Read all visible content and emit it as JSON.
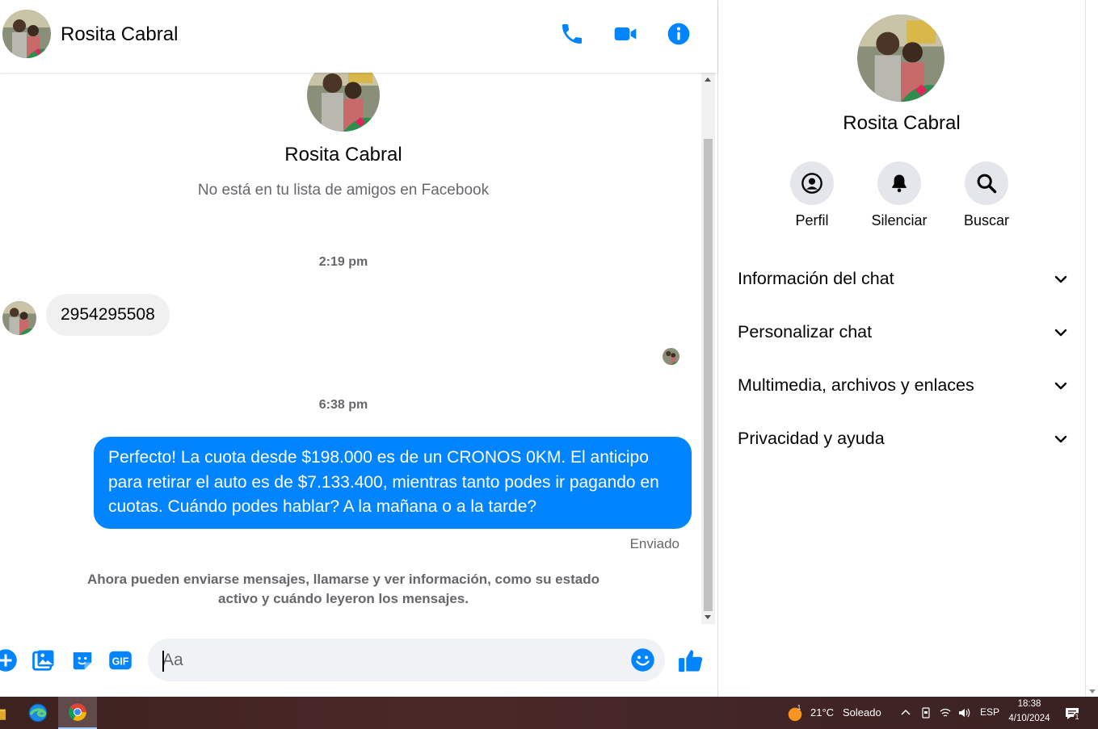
{
  "colors": {
    "accent": "#0084ff",
    "secondary_text": "#65676b",
    "incoming_bubble": "#f0f0f0",
    "panel_button_bg": "#e4e6eb"
  },
  "header": {
    "contact_name": "Rosita Cabral",
    "icons": [
      "phone-icon",
      "video-camera-icon",
      "info-icon"
    ]
  },
  "conversation": {
    "profile_name": "Rosita Cabral",
    "profile_subtitle": "No está en tu lista de amigos en Facebook",
    "messages": [
      {
        "time": "2:19 pm",
        "direction": "incoming",
        "text": "2954295508"
      },
      {
        "time": "6:38 pm",
        "direction": "outgoing",
        "text": "Perfecto! La cuota desde $198.000 es de un CRONOS 0KM. El anticipo para retirar el auto es de $7.133.400, mientras tanto podes ir pagando en cuotas. Cuándo podes hablar? A la mañana o a la tarde?",
        "status": "Enviado"
      }
    ],
    "notice": "Ahora pueden enviarse mensajes, llamarse y ver información, como su estado activo y cuándo leyeron los mensajes."
  },
  "composer": {
    "placeholder": "Aa",
    "value": "",
    "icons": [
      "plus-icon",
      "photo-icon",
      "sticker-icon",
      "gif-icon",
      "emoji-icon",
      "thumbs-up-icon"
    ],
    "gif_label": "GIF"
  },
  "panel": {
    "name": "Rosita Cabral",
    "actions": [
      {
        "label": "Perfil",
        "icon": "profile-icon"
      },
      {
        "label": "Silenciar",
        "icon": "bell-icon"
      },
      {
        "label": "Buscar",
        "icon": "search-icon"
      }
    ],
    "sections": [
      {
        "label": "Información del chat"
      },
      {
        "label": "Personalizar chat"
      },
      {
        "label": "Multimedia, archivos y enlaces"
      },
      {
        "label": "Privacidad y ayuda"
      }
    ]
  },
  "taskbar": {
    "apps": [
      "file-explorer-icon",
      "edge-icon",
      "chrome-icon"
    ],
    "weather": {
      "badge": "1",
      "temperature": "21°C",
      "condition": "Soleado"
    },
    "language": "ESP",
    "time": "18:38",
    "date": "4/10/2024",
    "notification_count": "1"
  }
}
